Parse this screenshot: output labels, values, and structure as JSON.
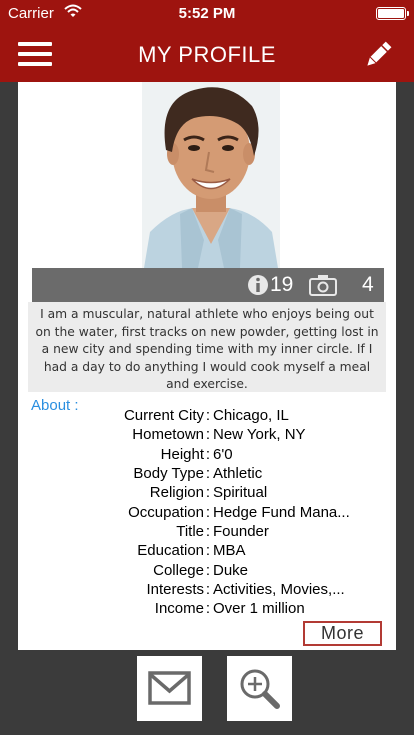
{
  "status_bar": {
    "carrier": "Carrier",
    "time": "5:52 PM"
  },
  "header": {
    "title": "MY PROFILE"
  },
  "profile": {
    "info_count": "19",
    "photo_count": "4",
    "bio": "I am a muscular, natural athlete who enjoys being out on the water, first tracks on new powder, getting lost in a new city and spending time with my inner circle. If I had a day to do anything I would  cook myself a meal and exercise."
  },
  "about": {
    "title": "About :",
    "fields": [
      {
        "label": "Current City",
        "value": "Chicago, IL"
      },
      {
        "label": "Hometown",
        "value": "New York, NY"
      },
      {
        "label": "Height",
        "value": "6'0"
      },
      {
        "label": "Body Type",
        "value": "Athletic"
      },
      {
        "label": "Religion",
        "value": " Spiritual"
      },
      {
        "label": "Occupation",
        "value": "Hedge Fund Mana..."
      },
      {
        "label": "Title",
        "value": "Founder"
      },
      {
        "label": "Education",
        "value": "MBA"
      },
      {
        "label": "College",
        "value": "Duke"
      },
      {
        "label": "Interests",
        "value": "Activities, Movies,..."
      },
      {
        "label": "Income",
        "value": "Over 1 million"
      }
    ]
  },
  "actions": {
    "more_label": "More"
  },
  "icons": {
    "menu": "hamburger-menu-icon",
    "edit": "pencil-icon",
    "info": "info-icon",
    "camera": "camera-icon",
    "message": "envelope-icon",
    "zoom": "magnifier-plus-icon"
  },
  "colors": {
    "brand": "#9e140f",
    "link": "#2a8fe0",
    "background": "#3b3b3b",
    "stats_bar": "#6b6b6b"
  }
}
